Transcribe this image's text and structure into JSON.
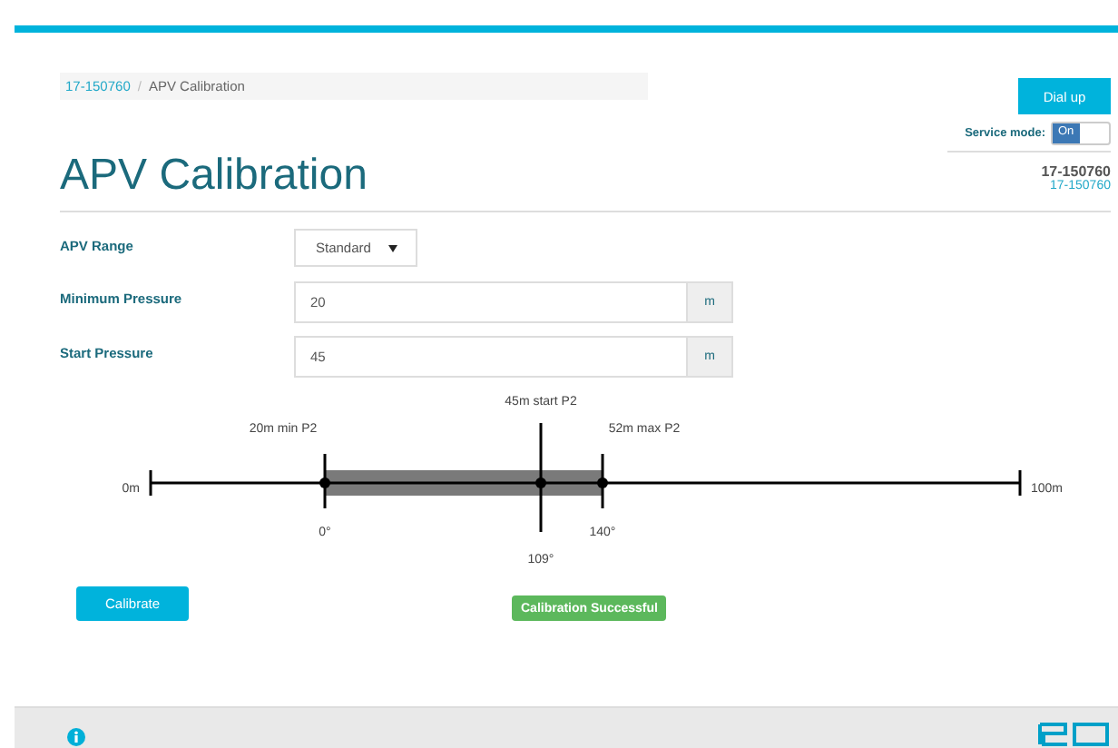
{
  "breadcrumb": [
    {
      "label": "17-150760",
      "kind": "link"
    },
    {
      "label": "/",
      "kind": "separator"
    },
    {
      "label": "APV Calibration",
      "kind": "current"
    }
  ],
  "dial_button": "Dial up",
  "service_mode": {
    "label": "Service mode:",
    "on": true,
    "state_label": "On"
  },
  "title": "APV Calibration",
  "device": {
    "name": "17-150760",
    "link": "17-150760"
  },
  "form": [
    {
      "label": "APV Range",
      "kind": "select",
      "value": "Standard"
    },
    {
      "label": "Minimum Pressure",
      "kind": "input",
      "value": "20",
      "unit": "m"
    },
    {
      "label": "Start Pressure",
      "kind": "input",
      "value": "45",
      "unit": "m"
    }
  ],
  "scale": {
    "start_label": "0m",
    "end_label": "100m",
    "markers": [
      {
        "label": "20m min P2",
        "angle": "0°"
      },
      {
        "label": "45m start P2",
        "angle": "109°"
      },
      {
        "label": "52m max P2",
        "angle": "140°"
      }
    ]
  },
  "calibrate_button": "Calibrate",
  "status": {
    "text": "Calibration Successful",
    "kind": "success"
  }
}
